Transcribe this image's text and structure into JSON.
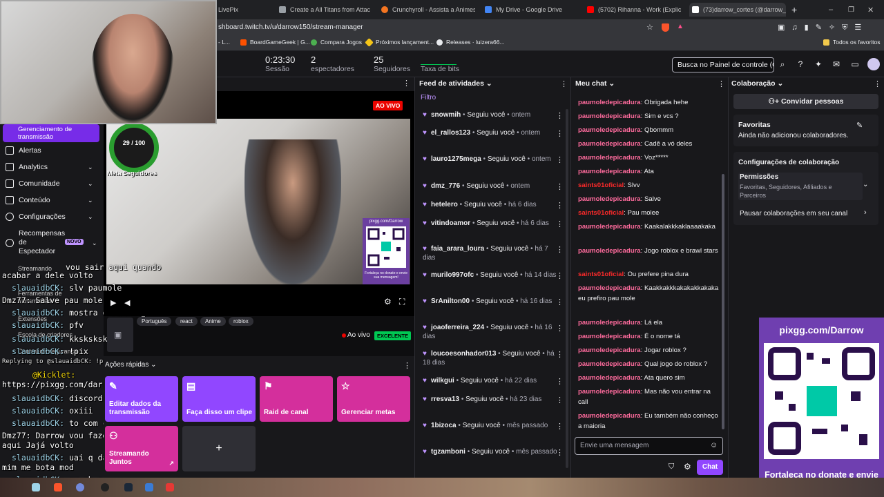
{
  "browser": {
    "tabs": [
      {
        "label": "LivePix",
        "color": "#00c853"
      },
      {
        "label": "Create a All Titans from Attack o",
        "color": "#9aa0a6"
      },
      {
        "label": "Crunchyroll - Assista a Animes, J",
        "color": "#f47521"
      },
      {
        "label": "My Drive - Google Drive",
        "color": "#4285f4"
      },
      {
        "label": "(5702) Rihanna - Work (Explicit)",
        "color": "#ff0000"
      },
      {
        "label": "(73)darrow_cortes (@darrow_co",
        "color": "#ffffff"
      }
    ],
    "url": "shboard.twitch.tv/u/darrow150/stream-manager",
    "bookmarks": [
      "- L...",
      "BoardGameGeek | G...",
      "Compara Jogos",
      "Próximos lançament...",
      "Releases · luizera66...",
      "Todos os favoritos"
    ]
  },
  "topbar": {
    "session_time": "0:23:30",
    "session_label": "Sessão",
    "viewers": "2",
    "viewers_label": "espectadores",
    "followers": "25",
    "followers_label": "Seguidores",
    "bits_label": "Taxa de bits",
    "search_placeholder": "Busca no Painel de controle (C"
  },
  "leftnav": {
    "selected": "Gerenciamento de transmissão",
    "items": [
      "Alertas",
      "Analytics",
      "Comunidade",
      "Conteúdo",
      "Configurações",
      "Recompensas de Espectador"
    ],
    "novo": "NOVO",
    "more": [
      "Streamando",
      "Ferramentas de transmissão",
      "Extensões",
      "Escola de criadores",
      "Central de segurança"
    ]
  },
  "terminal": {
    "lines": [
      {
        "user": "",
        "text": "vou sair aqui quando"
      },
      {
        "user": "",
        "text": "acabar a dele volto"
      },
      {
        "user": "slauaidbCK:",
        "text": "slv paumole"
      },
      {
        "user": "Dmz77:",
        "text": "Salve pau mole"
      },
      {
        "user": "slauaidbCK:",
        "text": "mostra o ranking"
      },
      {
        "user": "slauaidbCK:",
        "text": "pfv"
      },
      {
        "user": "slauaidbCK:",
        "text": "kkskskskms"
      },
      {
        "user": "slauaidbCK:",
        "text": "!pix"
      },
      {
        "user": "",
        "text": "Replying to @slauaidbCK: !pix"
      },
      {
        "user": "@Kicklet:",
        "text": ""
      },
      {
        "user": "",
        "text": "https://pixgg.com/darrow"
      },
      {
        "user": "slauaidbCK:",
        "text": "discord ne ja vi"
      },
      {
        "user": "slauaidbCK:",
        "text": "oxiii"
      },
      {
        "user": "slauaidbCK:",
        "text": "to com cara de mod agr"
      },
      {
        "user": "Dmz77:",
        "text": "Darrow vou fazer um bagulho"
      },
      {
        "user": "",
        "text": "aqui Jajá volto"
      },
      {
        "user": "slauaidbCK:",
        "text": "uai q dar trampo pra"
      },
      {
        "user": "",
        "text": "mim me bota mod"
      },
      {
        "user": "slauaidbCK:",
        "text": "ou eh o ranking ta com"
      }
    ]
  },
  "video": {
    "live_badge": "AO VIVO",
    "goal": "29 / 100",
    "goal_label": "Meta Seguidores",
    "qr_small_url": "pixgg.com/Darrow",
    "qr_small_caption": "Fortaleça no donate e envie sua mensagem!",
    "tags": [
      "Português",
      "react",
      "Anime",
      "roblox"
    ],
    "status": "Ao vivo",
    "quality": "EXCELENTE"
  },
  "quick_actions": {
    "title": "Ações rápidas",
    "items": [
      {
        "label": "Editar dados da transmissão",
        "color": "#9147ff"
      },
      {
        "label": "Faça disso um clipe",
        "color": "#9147ff"
      },
      {
        "label": "Raid de canal",
        "color": "#d42f9c"
      },
      {
        "label": "Gerenciar metas",
        "color": "#d42f9c"
      },
      {
        "label": "Streamando Juntos",
        "color": "#d42f9c"
      },
      {
        "label": "+",
        "color": "#2f2f35"
      }
    ]
  },
  "feed": {
    "title": "Feed de atividades",
    "filter": "Filtro",
    "items": [
      {
        "user": "snowmih",
        "action": "Seguiu você",
        "time": "ontem"
      },
      {
        "user": "el_rallos123",
        "action": "Seguiu você",
        "time": "ontem"
      },
      {
        "user": "lauro1275mega",
        "action": "Seguiu você",
        "time": "ontem"
      },
      {
        "user": "dmz_776",
        "action": "Seguiu você",
        "time": "ontem"
      },
      {
        "user": "hetelero",
        "action": "Seguiu você",
        "time": "há 6 dias"
      },
      {
        "user": "vitindoamor",
        "action": "Seguiu você",
        "time": "há 6 dias"
      },
      {
        "user": "faia_arara_loura",
        "action": "Seguiu você",
        "time": "há 7 dias"
      },
      {
        "user": "murilo997ofc",
        "action": "Seguiu você",
        "time": "há 14 dias"
      },
      {
        "user": "SrAnilton00",
        "action": "Seguiu você",
        "time": "há 16 dias"
      },
      {
        "user": "joaoferreira_224",
        "action": "Seguiu você",
        "time": "há 16 dias"
      },
      {
        "user": "loucoesonhador013",
        "action": "Seguiu você",
        "time": "há 18 dias"
      },
      {
        "user": "wilkgui",
        "action": "Seguiu você",
        "time": "há 22 dias"
      },
      {
        "user": "rresva13",
        "action": "Seguiu você",
        "time": "há 23 dias"
      },
      {
        "user": "1bizoca",
        "action": "Seguiu você",
        "time": "mês passado"
      },
      {
        "user": "tgzamboni",
        "action": "Seguiu você",
        "time": "mês passado"
      }
    ]
  },
  "chat": {
    "title": "Meu chat",
    "messages": [
      {
        "user": "paumoledepicadura",
        "text": "Obrigada hehe",
        "mod": false
      },
      {
        "user": "paumoledepicadura",
        "text": "Sim e vcs ?",
        "mod": false
      },
      {
        "user": "paumoledepicadura",
        "text": "Qbommm",
        "mod": false
      },
      {
        "user": "paumoledepicadura",
        "text": "Cadê a vó deles",
        "mod": false
      },
      {
        "user": "paumoledepicadura",
        "text": "Voz*****",
        "mod": false
      },
      {
        "user": "paumoledepicadura",
        "text": "Ata",
        "mod": false
      },
      {
        "user": "saints01oficial",
        "text": "Slvv",
        "mod": true
      },
      {
        "user": "paumoledepicadura",
        "text": "Salve",
        "mod": false
      },
      {
        "user": "saints01oficial",
        "text": "Pau molee",
        "mod": true
      },
      {
        "user": "paumoledepicadura",
        "text": "Kaakalakkkaklaaaakaka",
        "mod": false
      },
      {
        "user": "paumoledepicadura",
        "text": "Jogo roblox e brawl stars",
        "mod": false
      },
      {
        "user": "saints01oficial",
        "text": "Ou prefere pina dura",
        "mod": true
      },
      {
        "user": "paumoledepicadura",
        "text": "Kaakkakkkakakakkakaka eu prefiro pau mole",
        "mod": false
      },
      {
        "user": "paumoledepicadura",
        "text": "Lá ela",
        "mod": false
      },
      {
        "user": "paumoledepicadura",
        "text": "É o nome tá",
        "mod": false
      },
      {
        "user": "paumoledepicadura",
        "text": "Jogar roblox ?",
        "mod": false
      },
      {
        "user": "paumoledepicadura",
        "text": "Qual jogo do roblox ?",
        "mod": false
      },
      {
        "user": "paumoledepicadura",
        "text": "Ata quero sim",
        "mod": false
      },
      {
        "user": "paumoledepicadura",
        "text": "Mas não vou entrar na call",
        "mod": false
      },
      {
        "user": "paumoledepicadura",
        "text": "Eu também não conheço a maioria",
        "mod": false
      }
    ],
    "input_placeholder": "Envie uma mensagem",
    "send_label": "Chat"
  },
  "collab": {
    "title": "Colaboração",
    "invite": "Convidar pessoas",
    "fav_title": "Favoritas",
    "fav_desc": "Ainda não adicionou colaboradores.",
    "settings_title": "Configurações de colaboração",
    "perm_title": "Permissões",
    "perm_desc": "Favoritas, Seguidores, Afiliados e Parceiros",
    "pause": "Pausar colaborações em seu canal"
  },
  "qr_big": {
    "title": "pixgg.com/Darrow",
    "caption": "Fortaleça no donate e envie sua mensagem!"
  }
}
